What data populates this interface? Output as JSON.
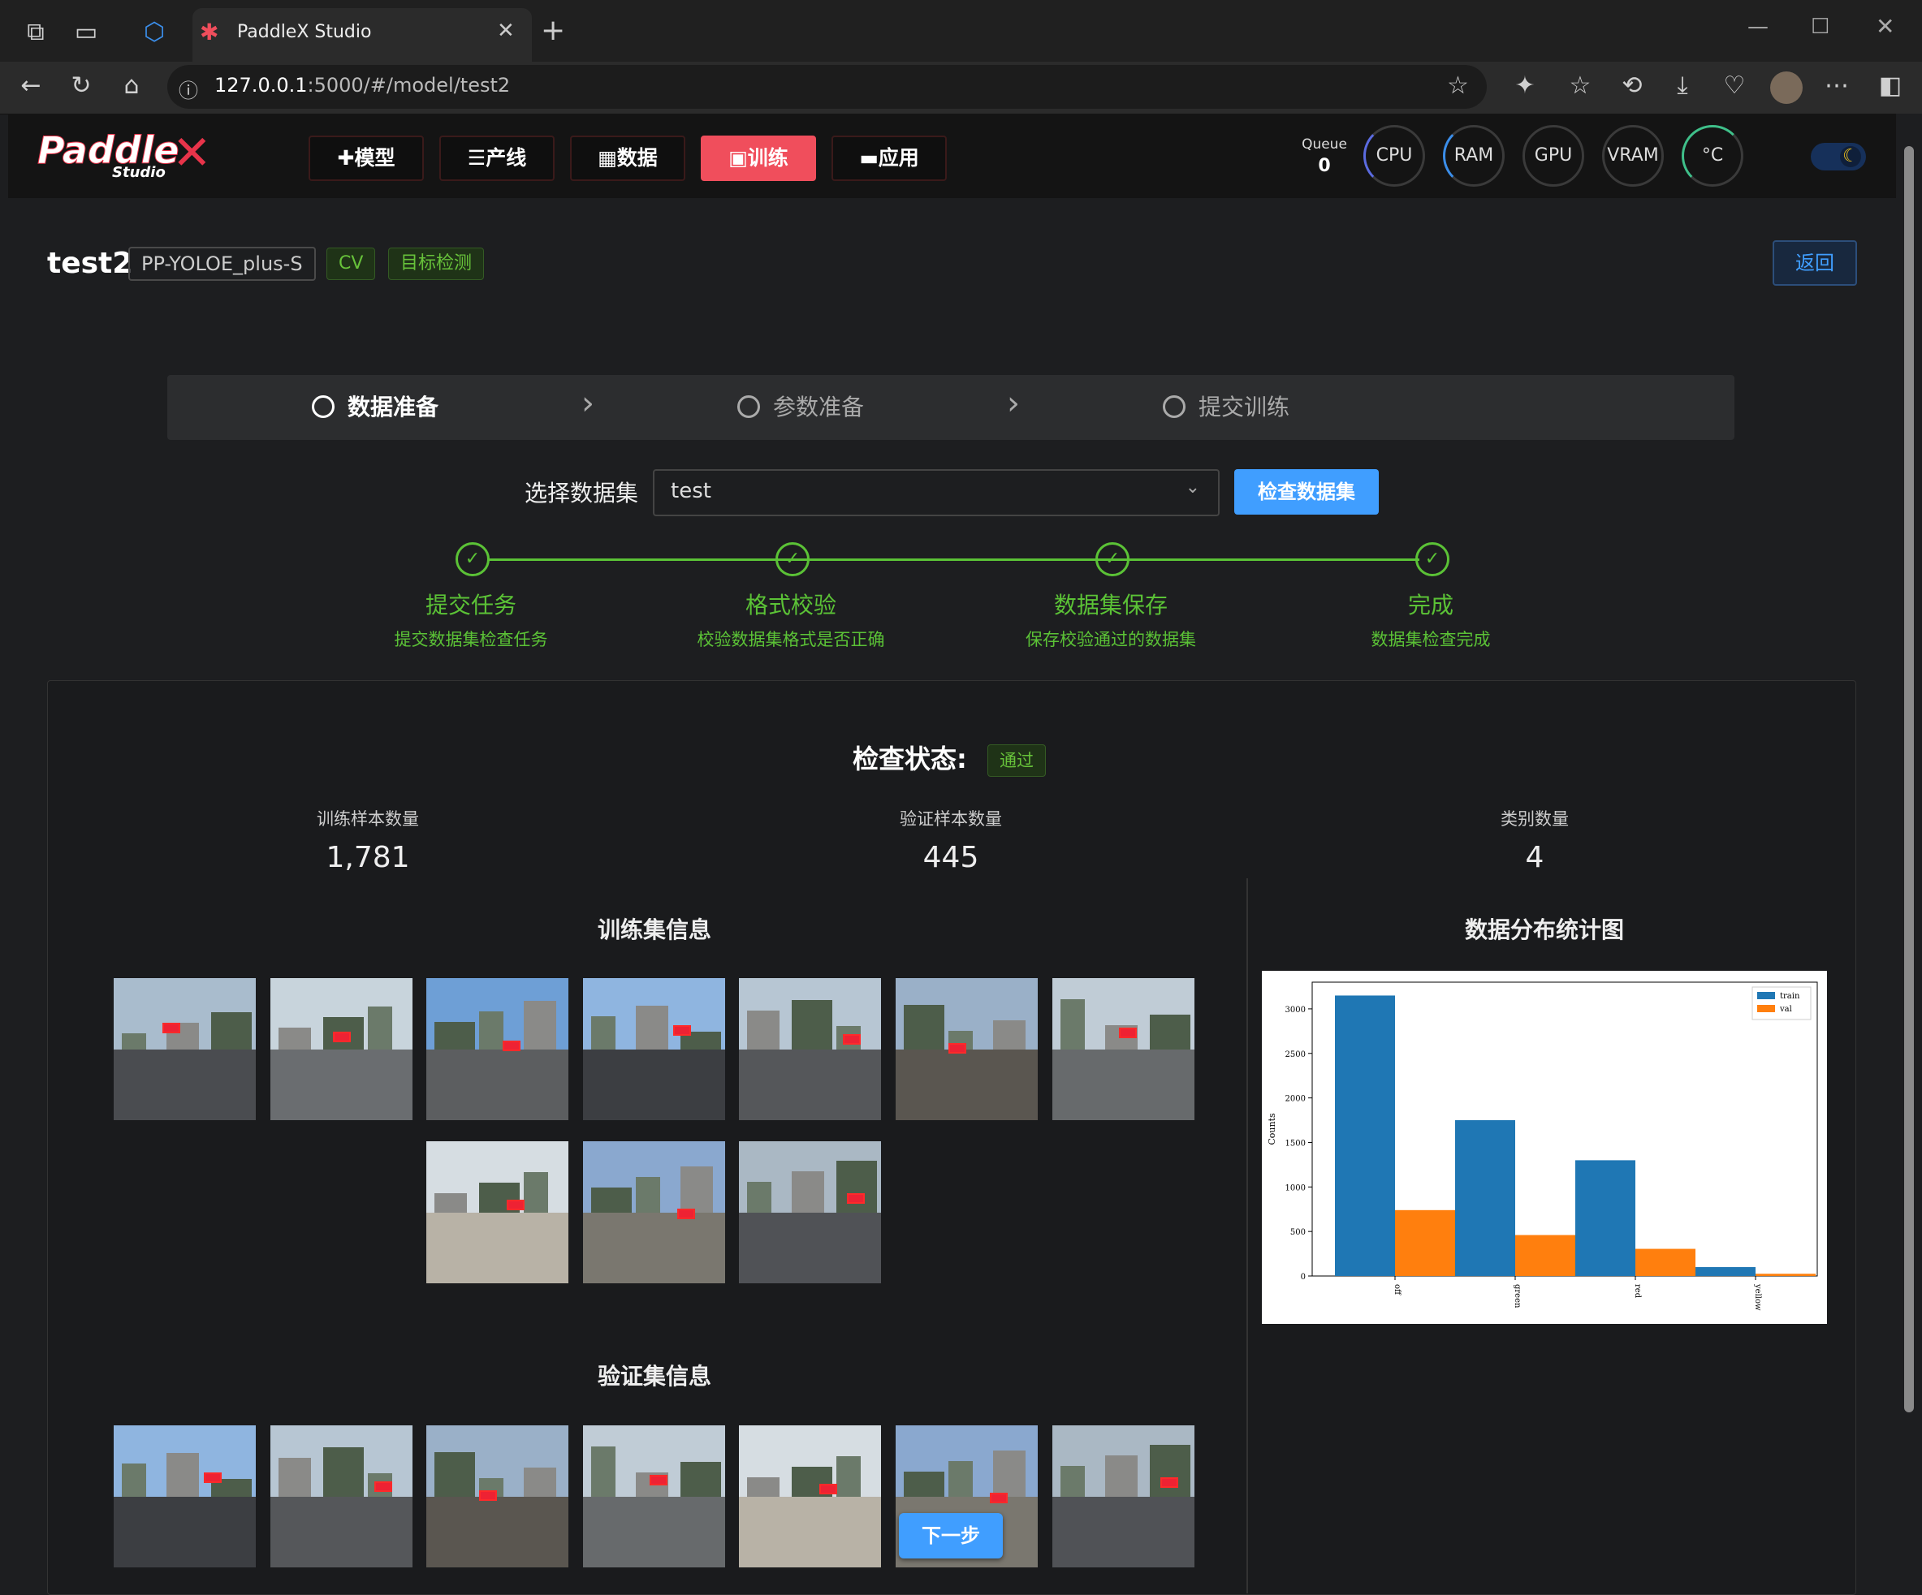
{
  "browser": {
    "tab_title": "PaddleX Studio",
    "url_host": "127.0.0.1",
    "url_path": ":5000/#/model/test2"
  },
  "header": {
    "logo_text": "Paddle",
    "logo_sub": "Studio",
    "nav": [
      {
        "label": "✚模型"
      },
      {
        "label": "☰产线"
      },
      {
        "label": "▦数据"
      },
      {
        "label": "▣训练"
      },
      {
        "label": "▬应用"
      }
    ],
    "queue_label": "Queue",
    "queue_value": "0",
    "gauges": [
      "CPU",
      "RAM",
      "GPU",
      "VRAM",
      "°C"
    ]
  },
  "model": {
    "name": "test2",
    "arch": "PP-YOLOE_plus-S",
    "tag_cv": "CV",
    "tag_task": "目标检测",
    "back_label": "返回"
  },
  "steps": [
    {
      "label": "数据准备"
    },
    {
      "label": "参数准备"
    },
    {
      "label": "提交训练"
    }
  ],
  "dataset": {
    "select_label": "选择数据集",
    "selected": "test",
    "check_button": "检查数据集"
  },
  "progress": [
    {
      "title": "提交任务",
      "desc": "提交数据集检查任务"
    },
    {
      "title": "格式校验",
      "desc": "校验数据集格式是否正确"
    },
    {
      "title": "数据集保存",
      "desc": "保存校验通过的数据集"
    },
    {
      "title": "完成",
      "desc": "数据集检查完成"
    }
  ],
  "result": {
    "status_label": "检查状态:",
    "status_value": "通过",
    "stats": [
      {
        "label": "训练样本数量",
        "value": "1,781"
      },
      {
        "label": "验证样本数量",
        "value": "445"
      },
      {
        "label": "类别数量",
        "value": "4"
      }
    ],
    "train_title": "训练集信息",
    "val_title": "验证集信息",
    "chart_title": "数据分布统计图",
    "next_button": "下一步"
  },
  "colors": {
    "train": "#1f77b4",
    "val": "#ff7f0e",
    "accent": "#f04e5c",
    "success": "#5bc236",
    "primary": "#409eff"
  },
  "chart_data": {
    "type": "bar",
    "categories": [
      "off",
      "green",
      "red",
      "yellow"
    ],
    "series": [
      {
        "name": "train",
        "values": [
          3150,
          1750,
          1300,
          100
        ]
      },
      {
        "name": "val",
        "values": [
          740,
          460,
          305,
          25
        ]
      }
    ],
    "ylabel": "Counts",
    "ylim": [
      0,
      3300
    ],
    "yticks": [
      0,
      500,
      1000,
      1500,
      2000,
      2500,
      3000
    ],
    "legend": "top-right"
  }
}
